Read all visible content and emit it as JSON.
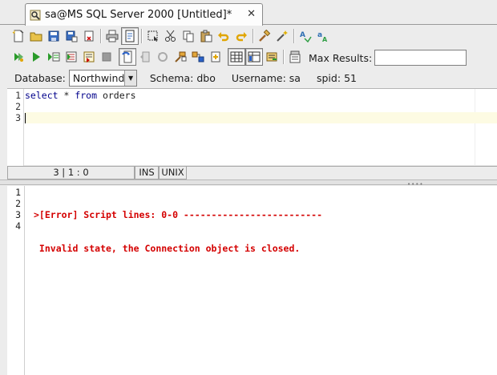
{
  "tab": {
    "title": "sa@MS SQL Server 2000 [Untitled]*",
    "close_glyph": "✕",
    "icon": "database-query-icon"
  },
  "toolbar": {
    "max_results_label": "Max Results:",
    "max_results_value": ""
  },
  "connection": {
    "database_label": "Database:",
    "database_value": "Northwind",
    "schema_label": "Schema:",
    "schema_value": "dbo",
    "username_label": "Username:",
    "username_value": "sa",
    "spid_label": "spid:",
    "spid_value": "51"
  },
  "editor": {
    "line_numbers": [
      "1",
      "2",
      "3"
    ],
    "line1": {
      "kw1": "select",
      "mid": " * ",
      "kw2": "from",
      "rest": " orders"
    }
  },
  "status": {
    "position": "3 | 1 : 0",
    "mode": "INS",
    "line_ending": "UNIX"
  },
  "output": {
    "line_numbers": [
      "1",
      "2",
      "3",
      "4"
    ],
    "lines": [
      ">[Error] Script lines: 0-0 -------------------------",
      " Invalid state, the Connection object is closed."
    ],
    "color": "#d40000"
  }
}
